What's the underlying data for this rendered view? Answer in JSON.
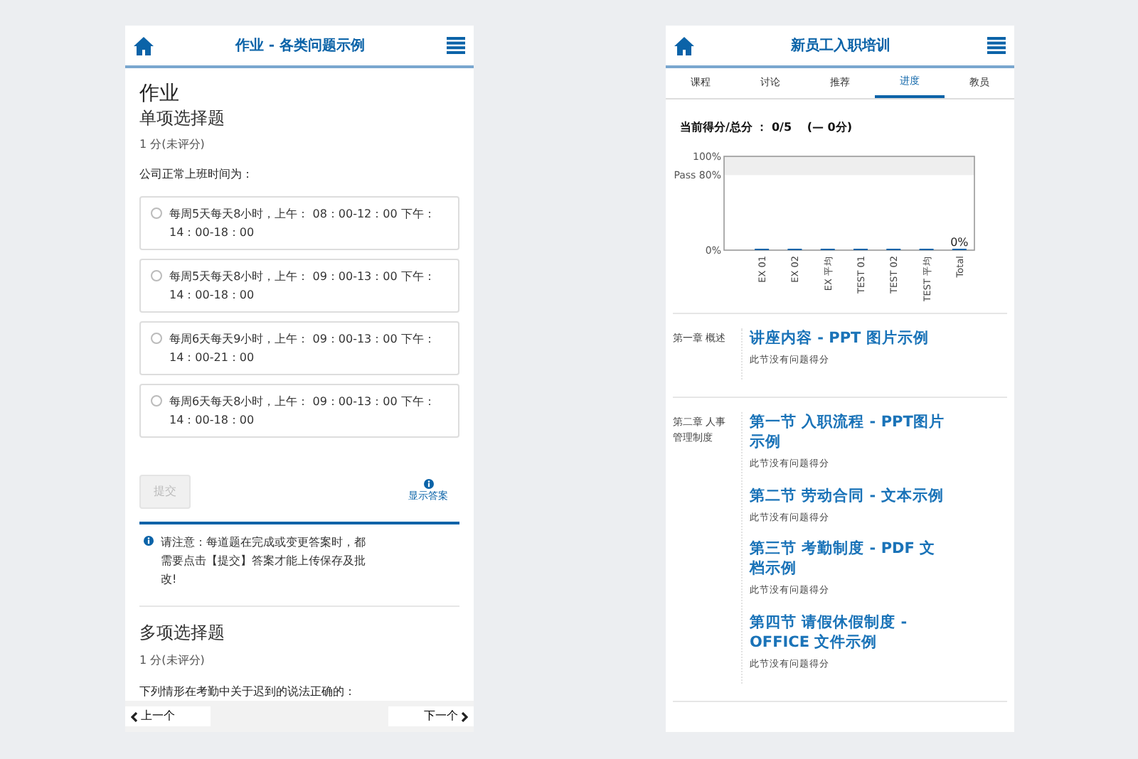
{
  "left_screen": {
    "title": "作业 - 各类问题示例",
    "heading": "作业",
    "question_1": {
      "title": "单项选择题",
      "score": "1 分(未评分)",
      "prompt": "公司正常上班时间为：",
      "options": [
        {
          "label": "每周5天每天8小时，上午： 08：00-12：00 下午：14：00-18：00",
          "selected": false
        },
        {
          "label": "每周5天每天8小时，上午： 09：00-13：00 下午：14：00-18：00",
          "selected": false
        },
        {
          "label": "每周6天每天9小时，上午： 09：00-13：00 下午：14：00-21：00",
          "selected": false
        },
        {
          "label": "每周6天每天8小时，上午： 09：00-13：00 下午：14：00-18：00",
          "selected": false
        }
      ],
      "submit": {
        "label": "提交",
        "disabled": true
      },
      "show_answer": "显示答案",
      "notice": "请注意：每道题在完成或变更答案时，都需要点击【提交】答案才能上传保存及批改!"
    },
    "question_2": {
      "title": "多项选择题",
      "score": "1 分(未评分)",
      "prompt": "下列情形在考勤中关于迟到的说法正确的："
    },
    "prev": "上一个",
    "next": "下一个"
  },
  "right_screen": {
    "title": "新员工入职培训",
    "tabs": [
      {
        "label": "课程",
        "selected": false
      },
      {
        "label": "讨论",
        "selected": false
      },
      {
        "label": "推荐",
        "selected": false
      },
      {
        "label": "进度",
        "selected": true
      },
      {
        "label": "教员",
        "selected": false
      }
    ],
    "score_summary": "当前得分/总分 ： 0/5　 (— 0分)",
    "chart_data": {
      "type": "bar",
      "categories": [
        "EX 01",
        "EX 02",
        "EX 平均",
        "TEST 01",
        "TEST 02",
        "TEST 平均",
        "Total"
      ],
      "values": [
        0,
        0,
        0,
        0,
        0,
        0,
        0
      ],
      "ylim": [
        0,
        100
      ],
      "yticks": [
        {
          "value": 0,
          "label": "0%"
        },
        {
          "value": 80,
          "label": "Pass 80%"
        },
        {
          "value": 100,
          "label": "100%"
        }
      ],
      "value_labels": [
        null,
        null,
        null,
        null,
        null,
        null,
        "0%"
      ],
      "bands": [
        {
          "axis": "y",
          "from": 80,
          "to": 100,
          "color": "#eeeeee"
        }
      ]
    },
    "chapters": [
      {
        "title": "第一章 概述",
        "sections": [
          {
            "title": "讲座内容 - PPT 图片示例",
            "status": "此节没有问题得分"
          }
        ]
      },
      {
        "title": "第二章 人事管理制度",
        "sections": [
          {
            "title": "第一节 入职流程 - PPT图片示例",
            "status": "此节没有问题得分"
          },
          {
            "title": "第二节 劳动合同 - 文本示例",
            "status": "此节没有问题得分"
          },
          {
            "title": "第三节 考勤制度 - PDF 文档示例",
            "status": "此节没有问题得分"
          },
          {
            "title": "第四节 请假休假制度 - OFFICE 文件示例",
            "status": "此节没有问题得分"
          }
        ]
      }
    ]
  }
}
